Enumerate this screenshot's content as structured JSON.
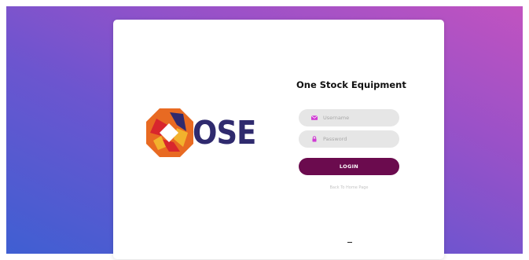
{
  "logo": {
    "text": "OSE",
    "colors": {
      "orange": "#e86a22",
      "red": "#d8262d",
      "navy": "#2f2a6e",
      "gold": "#f2b22d",
      "white": "#ffffff"
    }
  },
  "login": {
    "title": "One Stock Equipment",
    "username": {
      "placeholder": "Username",
      "value": "",
      "icon": "envelope-icon"
    },
    "password": {
      "placeholder": "Password",
      "value": "",
      "icon": "lock-icon"
    },
    "login_label": "LOGIN",
    "back_label": "Back To Home Page"
  },
  "footer": {
    "mark": "-"
  },
  "colors": {
    "accent": "#6b0b4e",
    "icon": "#d03ad4",
    "field_bg": "#e6e6e6",
    "title": "#111111"
  }
}
